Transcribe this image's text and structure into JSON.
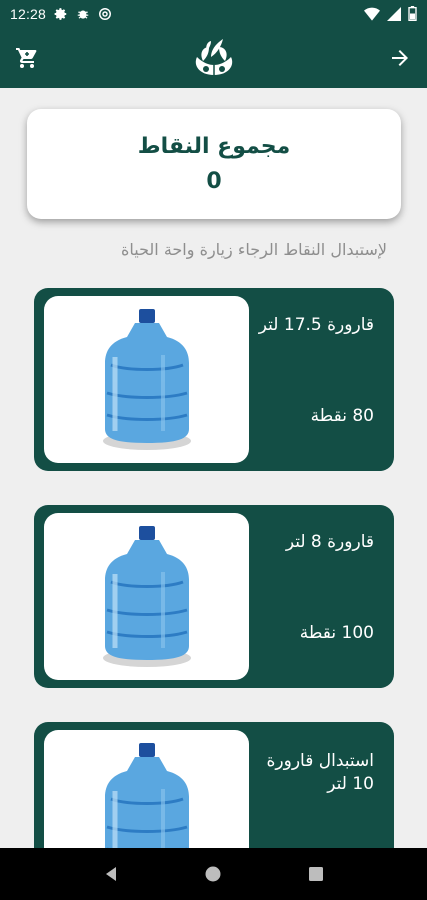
{
  "status_bar": {
    "time": "12:28",
    "icons_left": [
      "gear-icon",
      "bug-icon",
      "at-sign-icon"
    ],
    "icons_right": [
      "wifi-icon",
      "signal-icon",
      "battery-icon"
    ]
  },
  "app_bar": {
    "left_icon": "cart-icon",
    "center_icon": "leaf-logo-icon",
    "right_icon": "arrow-right-icon"
  },
  "points": {
    "title": "مجموع النقاط",
    "value": "0"
  },
  "hint": "لإستبدال النقاط الرجاء زيارة واحة الحياة",
  "products": [
    {
      "name": "قارورة 17.5 لتر",
      "points": "80 نقطة",
      "icon": "water-jug-icon"
    },
    {
      "name": "قارورة 8 لتر",
      "points": "100 نقطة",
      "icon": "water-jug-icon"
    },
    {
      "name": "استبدال قارورة 10 لتر",
      "points": "",
      "icon": "water-jug-icon"
    }
  ],
  "nav": {
    "icons": [
      "back-icon",
      "home-icon",
      "recents-icon"
    ]
  },
  "colors": {
    "primary": "#134e45",
    "background": "#efefef",
    "hint_text": "#8e8e8e"
  }
}
